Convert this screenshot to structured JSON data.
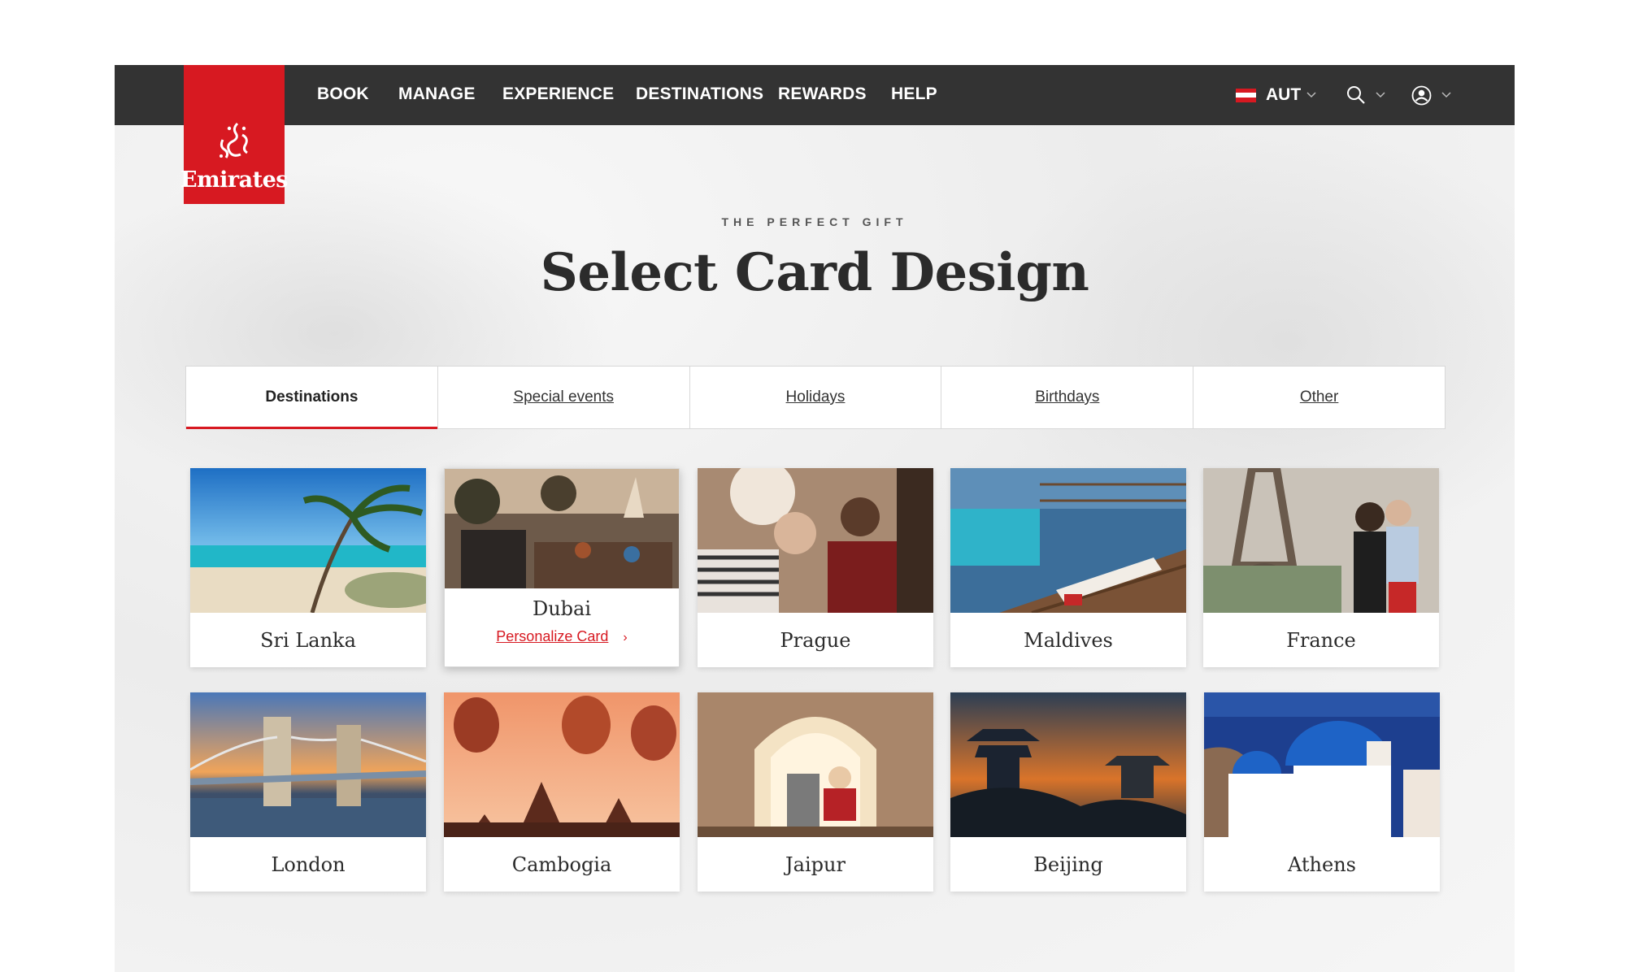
{
  "header": {
    "brand": "Emirates",
    "nav": [
      "BOOK",
      "MANAGE",
      "EXPERIENCE",
      "DESTINATIONS",
      "REWARDS",
      "HELP"
    ],
    "country": "AUT"
  },
  "hero": {
    "eyebrow": "THE PERFECT GIFT",
    "title": "Select Card Design"
  },
  "tabs": [
    {
      "label": "Destinations",
      "active": true
    },
    {
      "label": "Special events",
      "active": false
    },
    {
      "label": "Holidays",
      "active": false
    },
    {
      "label": "Birthdays",
      "active": false
    },
    {
      "label": "Other",
      "active": false
    }
  ],
  "cards": [
    {
      "name": "Sri Lanka"
    },
    {
      "name": "Dubai",
      "action": "Personalize Card"
    },
    {
      "name": "Prague"
    },
    {
      "name": "Maldives"
    },
    {
      "name": "France"
    },
    {
      "name": "London"
    },
    {
      "name": "Cambogia"
    },
    {
      "name": "Jaipur"
    },
    {
      "name": "Beijing"
    },
    {
      "name": "Athens"
    }
  ],
  "colors": {
    "brand_red": "#d71921",
    "topbar": "#333333"
  }
}
